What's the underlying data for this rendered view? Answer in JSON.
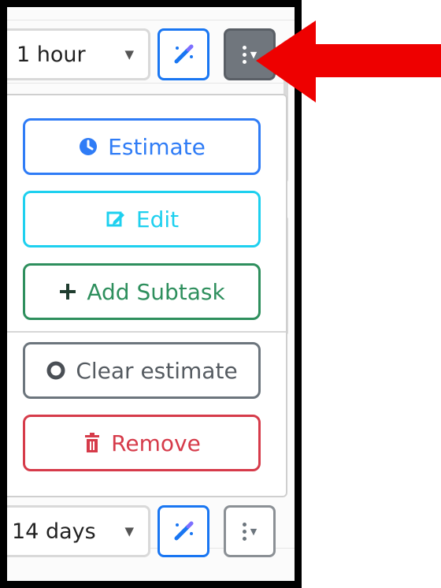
{
  "top_row": {
    "duration_value": "1 hour"
  },
  "bottom_row": {
    "duration_value": "14 days"
  },
  "menu": {
    "items": [
      {
        "label": "Estimate",
        "icon": "clock-icon"
      },
      {
        "label": "Edit",
        "icon": "edit-icon"
      },
      {
        "label": "Add Subtask",
        "icon": "plus-icon"
      },
      {
        "label": "Clear estimate",
        "icon": "circle-outline-icon"
      },
      {
        "label": "Remove",
        "icon": "trash-icon"
      }
    ]
  },
  "colors": {
    "primary": "#2f7cf6",
    "info": "#1ed0ef",
    "success": "#2e8f5d",
    "secondary": "#6c757d",
    "danger": "#d63b4a",
    "arrow": "#ee0000",
    "frame": "#000000"
  }
}
